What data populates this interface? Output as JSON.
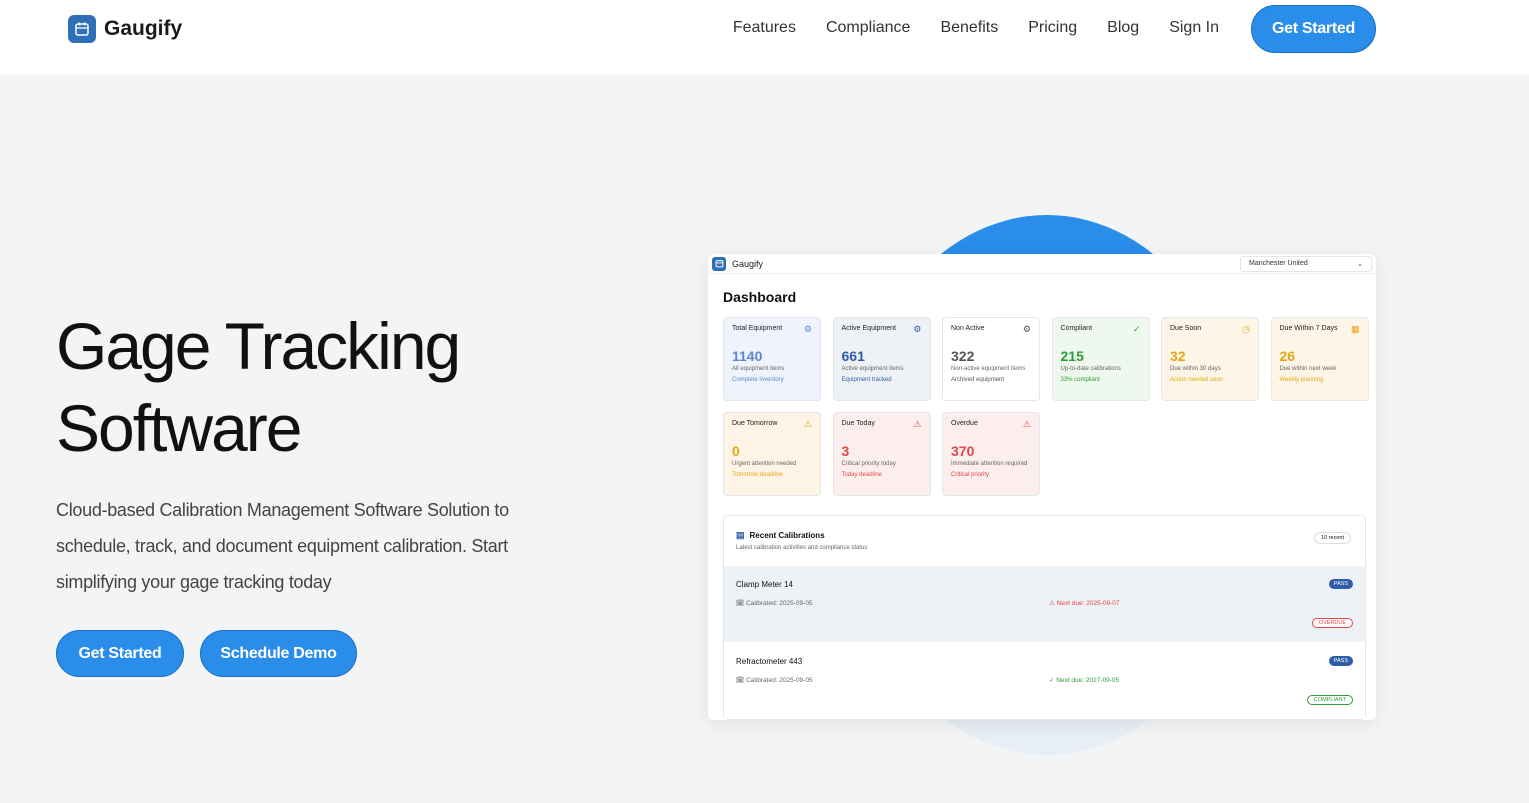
{
  "nav": {
    "brand": "Gaugify",
    "links": [
      "Features",
      "Compliance",
      "Benefits",
      "Pricing",
      "Blog",
      "Sign In"
    ],
    "cta": "Get Started"
  },
  "hero": {
    "title_line1": "Gage Tracking",
    "title_line2": "Software",
    "subtitle": "Cloud-based Calibration Management Software Solution to schedule, track, and document equipment calibration. Start simplifying your gage tracking today",
    "primary_cta": "Get Started",
    "secondary_cta": "Schedule Demo"
  },
  "dashboard": {
    "brand": "Gaugify",
    "org": "Manchester United",
    "title": "Dashboard",
    "stats": [
      {
        "label": "Total Equipment",
        "value": "1140",
        "desc": "All equipment items",
        "foot": "Complete inventory",
        "icon": "gear-icon",
        "color": "#5a86d6"
      },
      {
        "label": "Active Equipment",
        "value": "661",
        "desc": "Active equipment items",
        "foot": "Equipment tracked",
        "icon": "gear-icon",
        "color": "#2d5da8"
      },
      {
        "label": "Non Active",
        "value": "322",
        "desc": "Non-active equipment items",
        "foot": "Archived equipment",
        "icon": "gear-icon",
        "color": "#555555"
      },
      {
        "label": "Compliant",
        "value": "215",
        "desc": "Up-to-date calibrations",
        "foot": "33% compliant",
        "icon": "check-circle-icon",
        "color": "#2e9b3a"
      },
      {
        "label": "Due Soon",
        "value": "32",
        "desc": "Due within 30 days",
        "foot": "Action needed soon",
        "icon": "clock-icon",
        "color": "#e6a417"
      },
      {
        "label": "Due Within 7 Days",
        "value": "26",
        "desc": "Due within next week",
        "foot": "Weekly planning",
        "icon": "calendar-icon",
        "color": "#e6a417"
      },
      {
        "label": "Due Tomorrow",
        "value": "0",
        "desc": "Urgent attention needed",
        "foot": "Tomorrow deadline",
        "icon": "warning-icon",
        "color": "#e6a417"
      },
      {
        "label": "Due Today",
        "value": "3",
        "desc": "Critical priority today",
        "foot": "Today deadline",
        "icon": "warning-icon",
        "color": "#e04848"
      },
      {
        "label": "Overdue",
        "value": "370",
        "desc": "Immediate attention required",
        "foot": "Critical priority",
        "icon": "warning-icon",
        "color": "#e04848"
      }
    ],
    "recent": {
      "title": "Recent Calibrations",
      "subtitle": "Latest calibration activities and compliance status",
      "count": "10 recent",
      "rows": [
        {
          "name": "Clamp Meter 14",
          "calibrated": "Calibrated: 2025-09-05",
          "next": "Next due: 2025-09-07",
          "result": "PASS",
          "status": "OVERDUE"
        },
        {
          "name": "Refractometer 443",
          "calibrated": "Calibrated: 2025-09-05",
          "next": "Next due: 2027-09-05",
          "result": "PASS",
          "status": "COMPLIANT"
        }
      ]
    }
  }
}
